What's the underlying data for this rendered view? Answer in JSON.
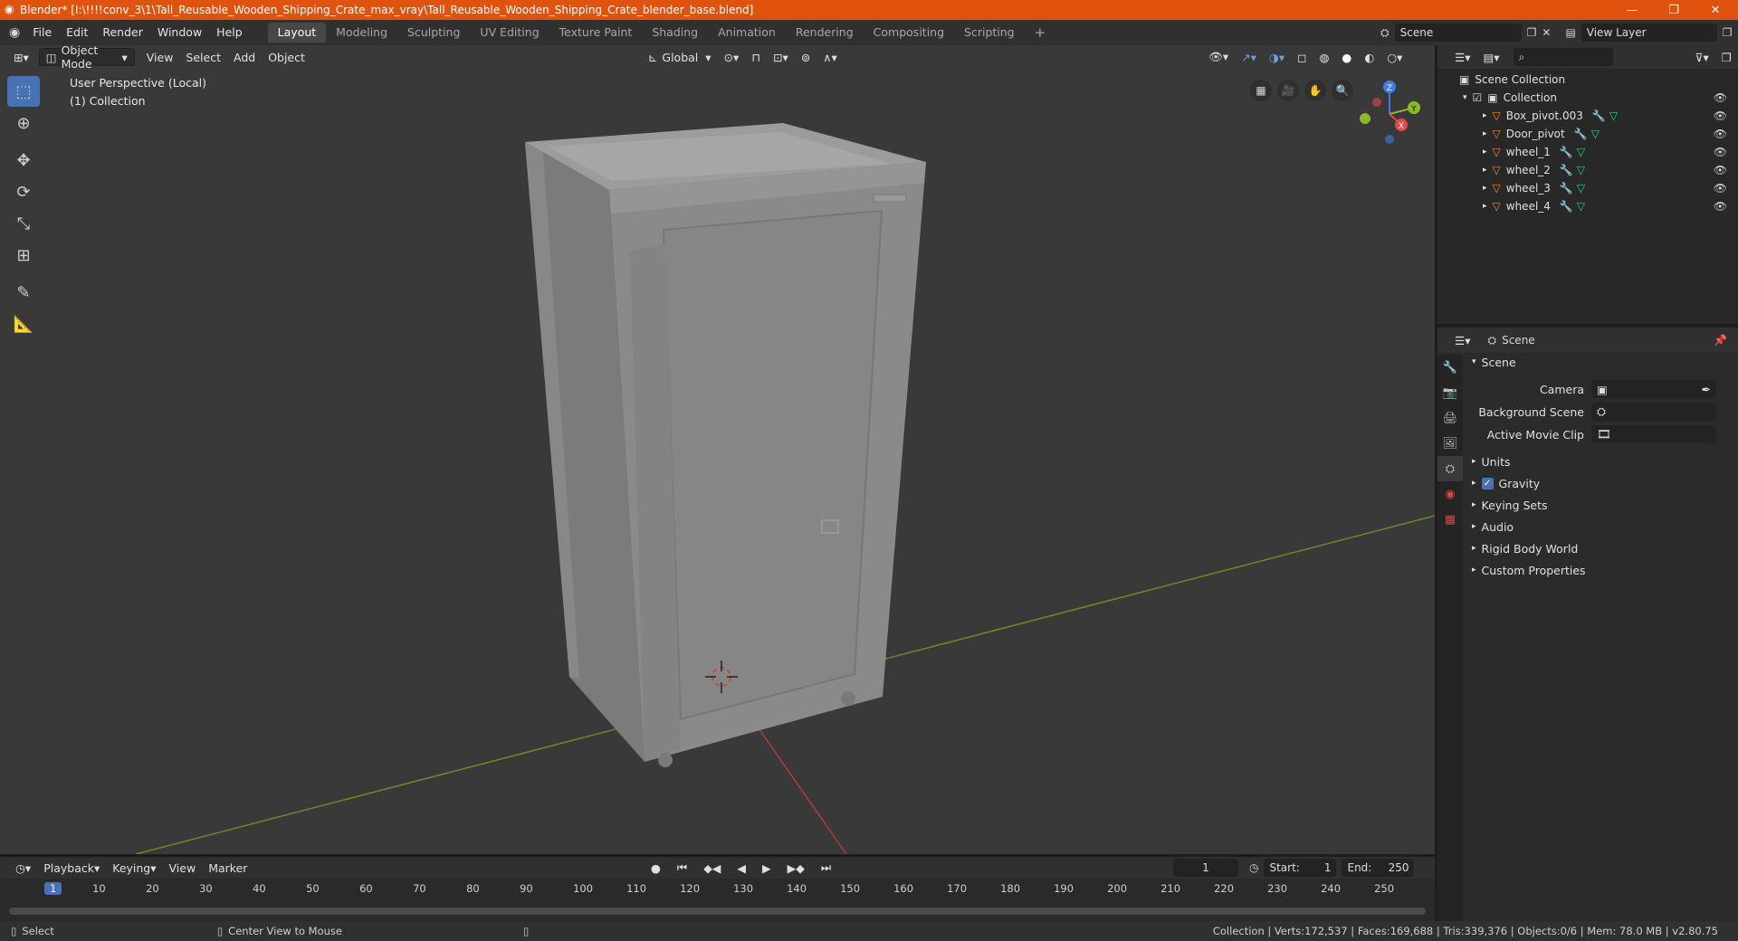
{
  "window": {
    "title": "Blender* [I:\\!!!!conv_3\\1\\Tall_Reusable_Wooden_Shipping_Crate_max_vray\\Tall_Reusable_Wooden_Shipping_Crate_blender_base.blend]",
    "accent": "#e0530f"
  },
  "menu": {
    "items": [
      "File",
      "Edit",
      "Render",
      "Window",
      "Help"
    ]
  },
  "workspaces": {
    "tabs": [
      "Layout",
      "Modeling",
      "Sculpting",
      "UV Editing",
      "Texture Paint",
      "Shading",
      "Animation",
      "Rendering",
      "Compositing",
      "Scripting"
    ],
    "active": "Layout"
  },
  "scene_selector": {
    "value": "Scene"
  },
  "view_layer_selector": {
    "value": "View Layer"
  },
  "viewport": {
    "mode": "Object Mode",
    "menus": [
      "View",
      "Select",
      "Add",
      "Object"
    ],
    "transform_orientation": "Global",
    "info_line1": "User Perspective (Local)",
    "info_line2": "(1) Collection",
    "gizmo": {
      "x": "X",
      "y": "Y",
      "z": "Z"
    },
    "colors": {
      "x_axis": "#e34a4a",
      "y_axis": "#8cb82c",
      "z_axis": "#3f7de0",
      "active_tool": "#4772b3"
    }
  },
  "outliner": {
    "search_placeholder": "",
    "root": "Scene Collection",
    "collection": "Collection",
    "objects": [
      "Box_pivot.003",
      "Door_pivot",
      "wheel_1",
      "wheel_2",
      "wheel_3",
      "wheel_4"
    ]
  },
  "properties": {
    "context": "Scene",
    "panel": "Scene",
    "fields": [
      {
        "label": "Camera",
        "value": ""
      },
      {
        "label": "Background Scene",
        "value": ""
      },
      {
        "label": "Active Movie Clip",
        "value": ""
      }
    ],
    "sections": [
      "Units",
      "Gravity",
      "Keying Sets",
      "Audio",
      "Rigid Body World",
      "Custom Properties"
    ],
    "gravity_checked": true
  },
  "timeline": {
    "menus": [
      "Playback",
      "Keying",
      "View",
      "Marker"
    ],
    "current_frame": "1",
    "start_label": "Start:",
    "start": "1",
    "end_label": "End:",
    "end": "250",
    "ticks": [
      "1",
      "10",
      "20",
      "30",
      "40",
      "50",
      "60",
      "70",
      "80",
      "90",
      "100",
      "110",
      "120",
      "130",
      "140",
      "150",
      "160",
      "170",
      "180",
      "190",
      "200",
      "210",
      "220",
      "230",
      "240",
      "250"
    ]
  },
  "status": {
    "select": "Select",
    "center": "Center View to Mouse",
    "stats": "Collection | Verts:172,537 | Faces:169,688 | Tris:339,376 | Objects:0/6 | Mem: 78.0 MB | v2.80.75"
  }
}
